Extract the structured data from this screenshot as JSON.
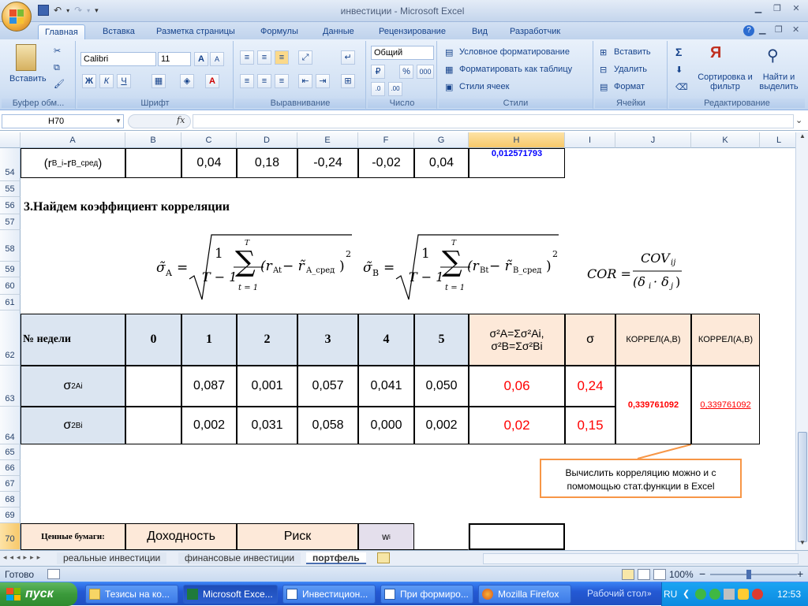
{
  "window": {
    "title": "инвестиции - Microsoft Excel"
  },
  "ribbon_tabs": [
    "Главная",
    "Вставка",
    "Разметка страницы",
    "Формулы",
    "Данные",
    "Рецензирование",
    "Вид",
    "Разработчик"
  ],
  "ribbon": {
    "clipboard": {
      "name": "Буфер обм...",
      "paste": "Вставить"
    },
    "font": {
      "name": "Шрифт",
      "family": "Calibri",
      "size": "11",
      "bold": "Ж",
      "italic": "К",
      "underline": "Ч",
      "grow": "A",
      "shrink": "A",
      "color_letter": "A"
    },
    "alignment": {
      "name": "Выравнивание"
    },
    "number": {
      "name": "Число",
      "format": "Общий",
      "percent": "%",
      "thousands": "000"
    },
    "styles": {
      "name": "Стили",
      "conditional": "Условное форматирование",
      "as_table": "Форматировать как таблицу",
      "cell_styles": "Стили ячеек"
    },
    "cells": {
      "name": "Ячейки",
      "insert": "Вставить",
      "delete": "Удалить",
      "format": "Формат"
    },
    "editing": {
      "name": "Редактирование",
      "sum": "Σ",
      "sort": "Сортировка и фильтр",
      "find": "Найти и выделить"
    },
    "help_glyph": "?"
  },
  "formula_bar": {
    "name_box": "H70",
    "fx": "fx",
    "formula": ""
  },
  "columns": [
    "A",
    "B",
    "C",
    "D",
    "E",
    "F",
    "G",
    "H",
    "I",
    "J",
    "K",
    "L"
  ],
  "rows": {
    "r54": {
      "label_main": "(r",
      "label_sub1": "B_i",
      "label_mid": "-r",
      "label_sub2": "B_сред",
      "label_end": ")",
      "values": [
        "0,04",
        "0,18",
        "-0,24",
        "-0,02",
        "0,04"
      ],
      "h_value": "0,012571793"
    },
    "r56": {
      "heading": "3.Найдем коэффициент корреляции"
    },
    "formulas": {
      "sigmaA_lhs": "σ̃",
      "sigmaA_sub": "A",
      "sigmaB_lhs": "σ̃",
      "sigmaB_sub": "B",
      "eq": "=",
      "one": "1",
      "denom": "T − 1",
      "sum_top": "T",
      "sum_bot": "t = 1",
      "sum": "∑",
      "termA": "(r",
      "termA_sub": "At",
      "minus": " − r̃",
      "termA_mean_sub": "A_сред",
      "close": ")",
      "power": "2",
      "termB_sub": "Bt",
      "termB_mean_sub": "B_сред",
      "cor_lhs": "COR =",
      "cov": "COV",
      "cov_sub": "ij",
      "delta_den": "(δ",
      "i": "i",
      "dot": "· δ",
      "j": "j",
      "paren": ")"
    },
    "r62": {
      "label": "№ недели",
      "weeks": [
        "0",
        "1",
        "2",
        "3",
        "4",
        "5"
      ],
      "h_line1": "σ²A=Σσ²Ai,",
      "h_line2": "σ²B=Σσ²Bi",
      "i_label": "σ",
      "j_label": "КОРРЕЛ(A,B)",
      "k_label": "КОРРЕЛ(A,B)"
    },
    "r63": {
      "label": "σ",
      "label_sup": "2",
      "label_sub": "Ai",
      "values": [
        "",
        "0,087",
        "0,001",
        "0,057",
        "0,041",
        "0,050"
      ],
      "h_value": "0,06",
      "i_value": "0,24"
    },
    "r64": {
      "label": "σ",
      "label_sup": "2",
      "label_sub": "Bi",
      "values": [
        "",
        "0,002",
        "0,031",
        "0,058",
        "0,000",
        "0,002"
      ],
      "h_value": "0,02",
      "i_value": "0,15"
    },
    "corr": {
      "j_value": "0,339761092",
      "k_value": "0,339761092"
    },
    "callout": {
      "text": "Вычислить корреляцию можно и с помомощью стат.функции в Excel"
    },
    "r70": {
      "label": "Ценные бумаги:",
      "dohod": "Доходность",
      "risk": "Риск",
      "w": "w",
      "w_sub": "i"
    }
  },
  "row_numbers": [
    "54",
    "55",
    "56",
    "57",
    "58",
    "59",
    "60",
    "61",
    "62",
    "63",
    "64",
    "65",
    "66",
    "67",
    "68",
    "69",
    "70"
  ],
  "sheet_tabs": [
    "реальные инвестиции",
    "финансовые инвестиции",
    "портфель"
  ],
  "status": {
    "ready": "Готово",
    "zoom": "100%",
    "zoom_minus": "−",
    "zoom_plus": "+"
  },
  "taskbar": {
    "start": "пуск",
    "items": [
      "Тезисы на ко...",
      "Microsoft Exce...",
      "Инвестицион...",
      "При формиро...",
      "Mozilla Firefox"
    ],
    "desktop": "Рабочий стол",
    "lang": "RU",
    "clock": "12:53"
  },
  "colors": {
    "accent": "#15428b",
    "header_fill": "#dbe5f1",
    "orange_fill": "#fde9d9",
    "red": "#ff0000",
    "blue_text": "#0000ff",
    "callout_border": "#f79646"
  }
}
